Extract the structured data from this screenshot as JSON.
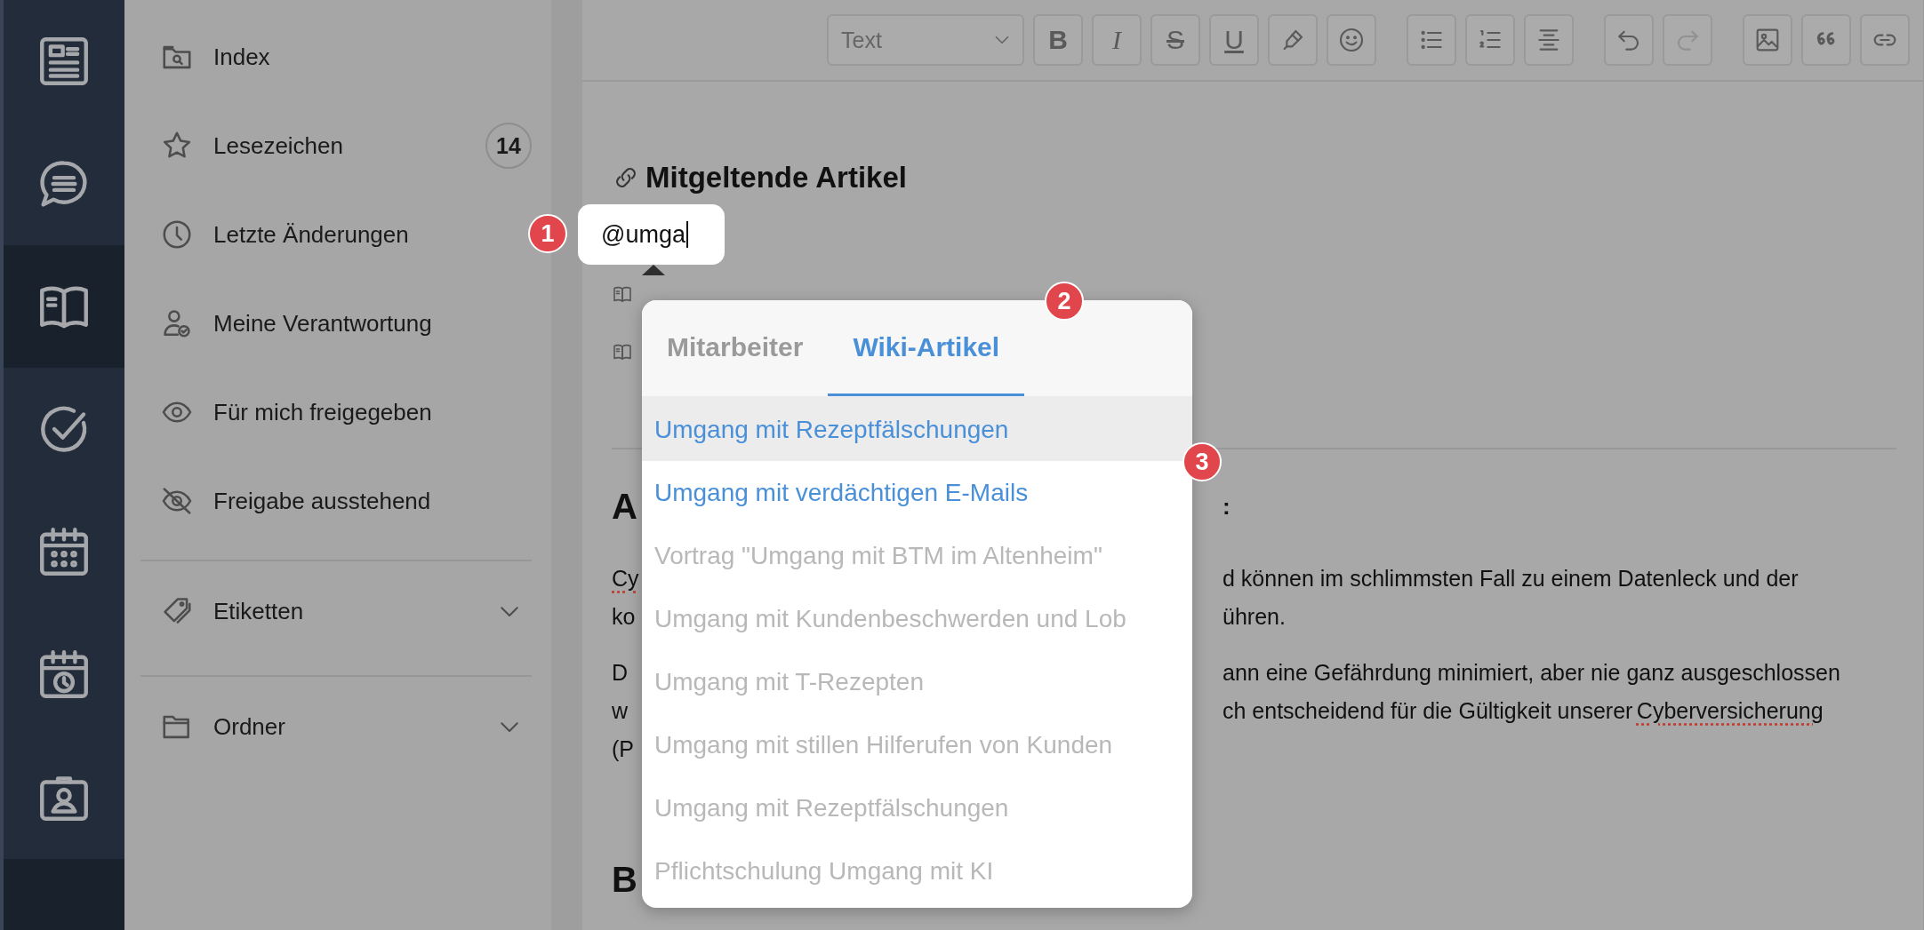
{
  "rail": [
    {
      "kind": "news",
      "selected": false
    },
    {
      "kind": "chat",
      "selected": false
    },
    {
      "kind": "book",
      "selected": true
    },
    {
      "kind": "check",
      "selected": false
    },
    {
      "kind": "calendar",
      "selected": false
    },
    {
      "kind": "schedule",
      "selected": false
    },
    {
      "kind": "contact",
      "selected": false
    }
  ],
  "sidebar": {
    "items": [
      {
        "label": "Index"
      },
      {
        "label": "Lesezeichen",
        "count": "14"
      },
      {
        "label": "Letzte Änderungen"
      },
      {
        "label": "Meine Verantwortung"
      },
      {
        "label": "Für mich freigegeben"
      },
      {
        "label": "Freigabe ausstehend"
      }
    ],
    "groups": [
      {
        "label": "Etiketten",
        "expanded": false
      },
      {
        "label": "Ordner",
        "expanded": false
      }
    ]
  },
  "toolbar": {
    "block_format": "Text",
    "button_groups": [
      [
        {
          "kind": "bold",
          "label": "B",
          "disabled": false
        },
        {
          "kind": "italic",
          "label": "I",
          "disabled": false
        },
        {
          "kind": "strike",
          "label": "S",
          "disabled": false
        },
        {
          "kind": "underline",
          "label": "U",
          "disabled": false
        },
        {
          "kind": "highlight",
          "disabled": false
        },
        {
          "kind": "emoji",
          "disabled": false
        }
      ],
      [
        {
          "kind": "bullet-list",
          "disabled": false
        },
        {
          "kind": "numbered-list",
          "disabled": false
        },
        {
          "kind": "align",
          "disabled": false
        }
      ],
      [
        {
          "kind": "undo",
          "disabled": false
        },
        {
          "kind": "redo",
          "disabled": true
        }
      ],
      [
        {
          "kind": "image",
          "disabled": false
        },
        {
          "kind": "quote",
          "disabled": false
        },
        {
          "kind": "link",
          "disabled": false
        }
      ]
    ]
  },
  "editor": {
    "heading": "Mitgeltende Artikel",
    "mention": {
      "value": "@umga"
    },
    "links": [
      {
        "kind": "wiki-article"
      },
      {
        "kind": "wiki-article"
      }
    ],
    "blocks": [
      {
        "kind": "heading",
        "left": "A",
        "right": ":"
      },
      {
        "kind": "paragraph",
        "lines": [
          {
            "left": "Cy",
            "left_misspelled": true,
            "right": [
              {
                "text": "d können im schlimmsten Fall zu einem Datenleck und der",
                "misspelled": false
              }
            ]
          },
          {
            "left": "ko",
            "left_misspelled": false,
            "right": [
              {
                "text": "ühren.",
                "misspelled": false
              }
            ]
          }
        ]
      },
      {
        "kind": "paragraph",
        "lines": [
          {
            "left": "D",
            "left_misspelled": false,
            "right": [
              {
                "text": "ann eine Gefährdung minimiert, aber nie ganz ausgeschlossen",
                "misspelled": false
              }
            ]
          },
          {
            "left": "w",
            "left_misspelled": false,
            "right": [
              {
                "text": "ch entscheidend für die Gültigkeit unserer",
                "misspelled": false
              },
              {
                "text": "Cyberversicherung",
                "misspelled": true
              }
            ]
          },
          {
            "left": "(P",
            "left_misspelled": false
          }
        ]
      },
      {
        "kind": "heading",
        "left": "B"
      }
    ]
  },
  "mention_popup": {
    "tabs": [
      {
        "label": "Mitarbeiter",
        "selected": false
      },
      {
        "label": "Wiki-Artikel",
        "selected": true
      }
    ],
    "items": [
      {
        "label": "Umgang mit Rezeptfälschungen",
        "selected": true,
        "disabled": false
      },
      {
        "label": "Umgang mit verdächtigen E-Mails",
        "selected": false,
        "disabled": false
      },
      {
        "label": "Vortrag \"Umgang mit BTM im Altenheim\"",
        "selected": false,
        "disabled": true
      },
      {
        "label": "Umgang mit Kundenbeschwerden und Lob",
        "selected": false,
        "disabled": true
      },
      {
        "label": "Umgang mit T-Rezepten",
        "selected": false,
        "disabled": true
      },
      {
        "label": "Umgang mit stillen Hilferufen von Kunden",
        "selected": false,
        "disabled": true
      },
      {
        "label": "Umgang mit Rezeptfälschungen",
        "selected": false,
        "disabled": true
      },
      {
        "label": "Pflichtschulung Umgang mit KI",
        "selected": false,
        "disabled": true
      }
    ]
  },
  "annotations": [
    {
      "label": "1"
    },
    {
      "label": "2"
    },
    {
      "label": "3"
    }
  ]
}
